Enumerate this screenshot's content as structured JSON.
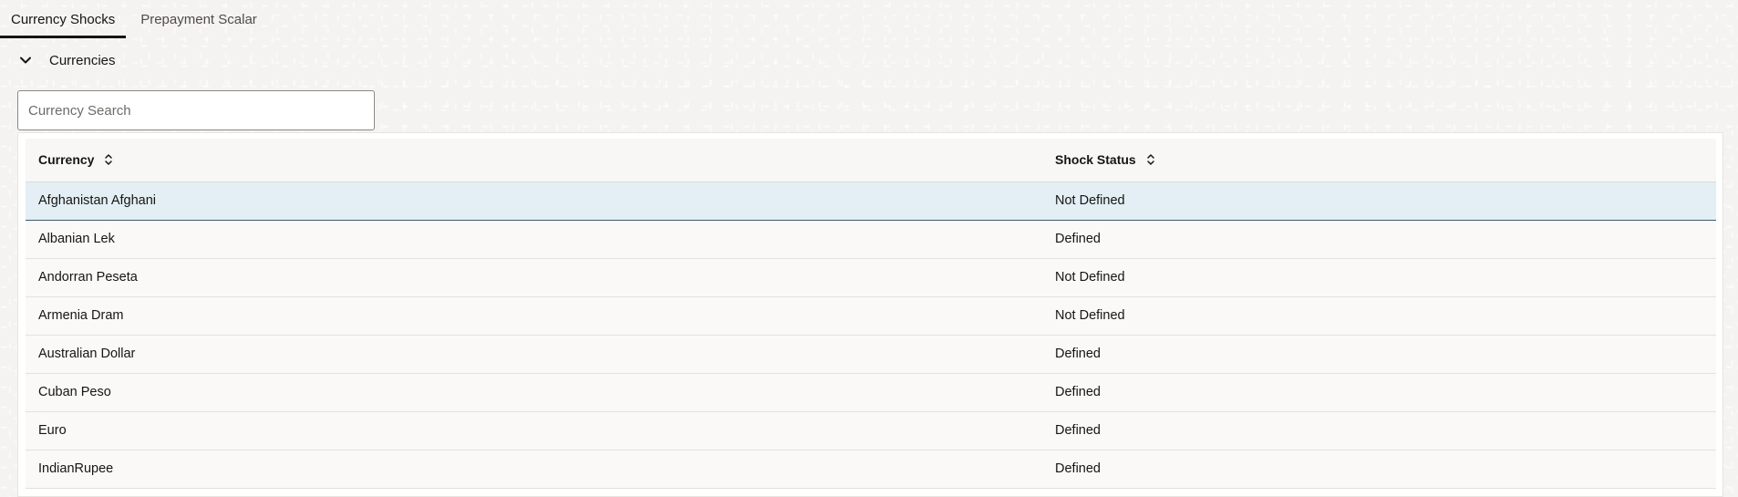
{
  "tabs": [
    {
      "label": "Currency Shocks",
      "active": true
    },
    {
      "label": "Prepayment Scalar",
      "active": false
    }
  ],
  "section": {
    "title": "Currencies",
    "expanded": true,
    "icon": "chevron-down-icon"
  },
  "search": {
    "placeholder": "Currency Search",
    "value": ""
  },
  "table": {
    "columns": [
      {
        "label": "Currency",
        "sort_icon": "sort-icon"
      },
      {
        "label": "Shock Status",
        "sort_icon": "sort-icon"
      }
    ],
    "rows": [
      {
        "currency": "Afghanistan Afghani",
        "status": "Not Defined",
        "selected": true
      },
      {
        "currency": "Albanian Lek",
        "status": "Defined"
      },
      {
        "currency": "Andorran Peseta",
        "status": "Not Defined"
      },
      {
        "currency": "Armenia Dram",
        "status": "Not Defined"
      },
      {
        "currency": "Australian Dollar",
        "status": "Defined"
      },
      {
        "currency": "Cuban Peso",
        "status": "Defined"
      },
      {
        "currency": "Euro",
        "status": "Defined"
      },
      {
        "currency": "IndianRupee",
        "status": "Defined"
      }
    ]
  }
}
